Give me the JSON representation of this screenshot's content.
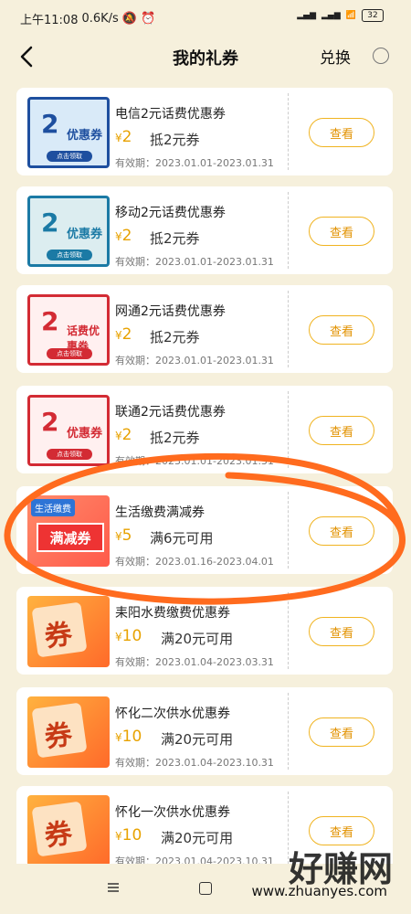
{
  "status": {
    "time": "上午11:08",
    "speed": "0.6K/s",
    "battery": "32"
  },
  "header": {
    "title": "我的礼券",
    "redeem": "兑换"
  },
  "colors": {
    "accent": "#e8a200",
    "button_border": "#f0b320",
    "background": "#f6f0dc",
    "scribble": "#ff6b1e"
  },
  "coupons": [
    {
      "name": "电信2元话费优惠券",
      "amount_symbol": "¥",
      "amount": "2",
      "condition": "抵2元券",
      "validity": "有效期：2023.01.01-2023.01.31",
      "button": "查看",
      "thumb_text": "优惠券",
      "thumb_big": "2",
      "thumb_pill": "点击领取"
    },
    {
      "name": "移动2元话费优惠券",
      "amount_symbol": "¥",
      "amount": "2",
      "condition": "抵2元券",
      "validity": "有效期：2023.01.01-2023.01.31",
      "button": "查看",
      "thumb_text": "优惠券",
      "thumb_big": "2",
      "thumb_pill": "点击领取"
    },
    {
      "name": "网通2元话费优惠券",
      "amount_symbol": "¥",
      "amount": "2",
      "condition": "抵2元券",
      "validity": "有效期：2023.01.01-2023.01.31",
      "button": "查看",
      "thumb_text": "话费优惠券",
      "thumb_big": "2",
      "thumb_pill": "点击领取"
    },
    {
      "name": "联通2元话费优惠券",
      "amount_symbol": "¥",
      "amount": "2",
      "condition": "抵2元券",
      "validity": "有效期：2023.01.01-2023.01.31",
      "button": "查看",
      "thumb_text": "优惠券",
      "thumb_big": "2",
      "thumb_pill": "点击领取"
    },
    {
      "name": "生活缴费满减券",
      "amount_symbol": "¥",
      "amount": "5",
      "condition": "满6元可用",
      "validity": "有效期：2023.01.16-2023.04.01",
      "button": "查看",
      "thumb_tag": "生活缴费",
      "thumb_main": "满减券"
    },
    {
      "name": "耒阳水费缴费优惠券",
      "amount_symbol": "¥",
      "amount": "10",
      "condition": "满20元可用",
      "validity": "有效期：2023.01.04-2023.03.31",
      "button": "查看",
      "thumb_seal": "券"
    },
    {
      "name": "怀化二次供水优惠券",
      "amount_symbol": "¥",
      "amount": "10",
      "condition": "满20元可用",
      "validity": "有效期：2023.01.04-2023.10.31",
      "button": "查看",
      "thumb_seal": "券"
    },
    {
      "name": "怀化一次供水优惠券",
      "amount_symbol": "¥",
      "amount": "10",
      "condition": "满20元可用",
      "validity": "有效期：2023.01.04-2023.10.31",
      "button": "查看",
      "thumb_seal": "券"
    }
  ],
  "watermark": {
    "text": "好赚网",
    "url": "www.zhuanyes.com"
  }
}
